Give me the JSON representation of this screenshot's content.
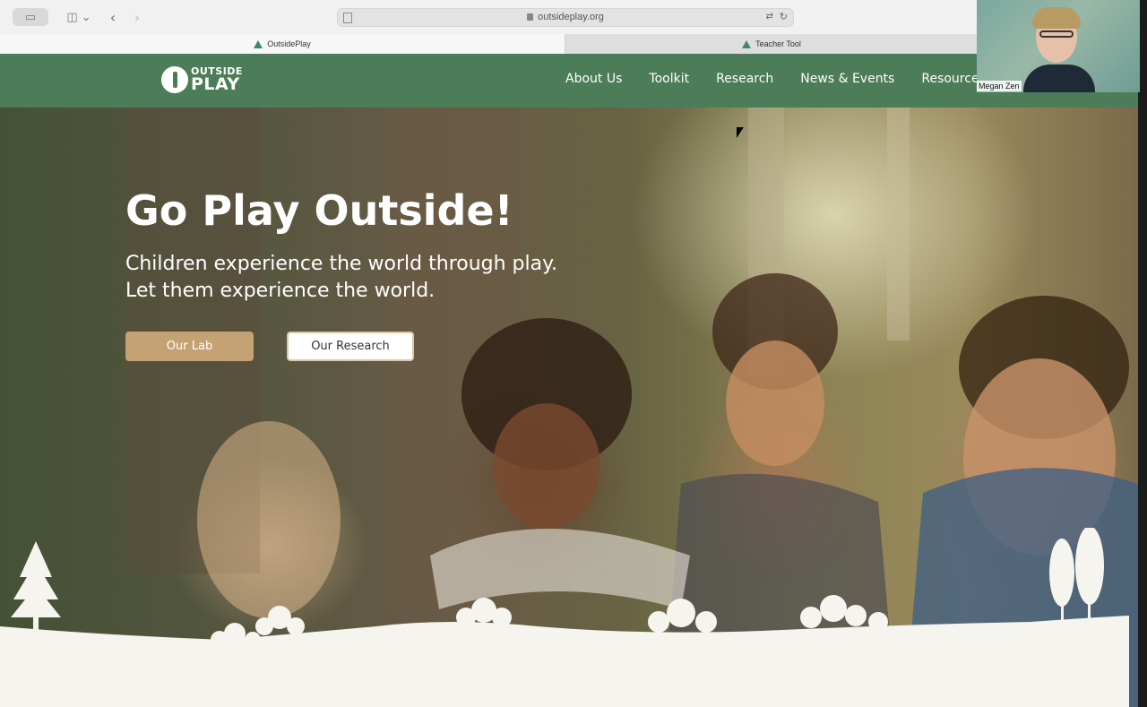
{
  "browser": {
    "url": "outsideplay.org",
    "tabs": [
      {
        "label": "OutsidePlay"
      },
      {
        "label": "Teacher Tool"
      }
    ]
  },
  "site": {
    "logo": {
      "top": "OUTSIDE",
      "bottom": "PLAY"
    },
    "nav": [
      "About Us",
      "Toolkit",
      "Research",
      "News & Events",
      "Resources"
    ],
    "brand_color": "#4d7d58"
  },
  "hero": {
    "title": "Go Play Outside!",
    "subtitle": "Children experience the world through play. Let them experience the world.",
    "buttons": {
      "lab": "Our Lab",
      "research": "Our Research"
    },
    "accent_color": "#c4a274"
  },
  "video": {
    "participant_name": "Megan Zen"
  }
}
